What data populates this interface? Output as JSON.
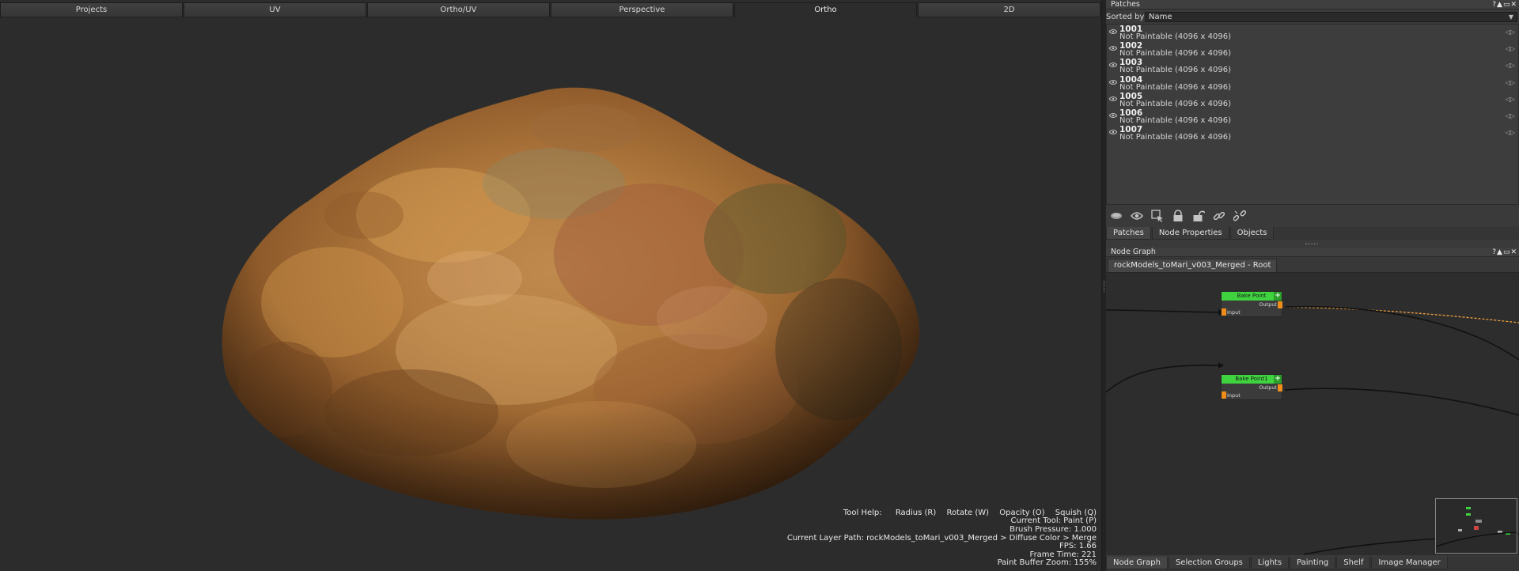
{
  "view_tabs": [
    {
      "label": "Projects",
      "active": false
    },
    {
      "label": "UV",
      "active": false
    },
    {
      "label": "Ortho/UV",
      "active": false
    },
    {
      "label": "Perspective",
      "active": false
    },
    {
      "label": "Ortho",
      "active": true
    },
    {
      "label": "2D",
      "active": false
    }
  ],
  "hud": {
    "help_label": "Tool Help:",
    "help_items": [
      "Radius (R)",
      "Rotate (W)",
      "Opacity (O)",
      "Squish (Q)"
    ],
    "lines": [
      "Current Tool: Paint (P)",
      "Brush Pressure: 1.000",
      "Current Layer Path: rockModels_toMari_v003_Merged > Diffuse Color > Merge",
      "FPS: 1.66",
      "Frame Time: 221",
      "Paint Buffer Zoom: 155%"
    ]
  },
  "patches_panel": {
    "title": "Patches",
    "window_buttons": "?▲▭✕",
    "sort_label": "Sorted by",
    "sort_value": "Name",
    "patches": [
      {
        "name": "1001",
        "state": "Not Paintable (4096 x 4096)"
      },
      {
        "name": "1002",
        "state": "Not Paintable (4096 x 4096)"
      },
      {
        "name": "1003",
        "state": "Not Paintable (4096 x 4096)"
      },
      {
        "name": "1004",
        "state": "Not Paintable (4096 x 4096)"
      },
      {
        "name": "1005",
        "state": "Not Paintable (4096 x 4096)"
      },
      {
        "name": "1006",
        "state": "Not Paintable (4096 x 4096)"
      },
      {
        "name": "1007",
        "state": "Not Paintable (4096 x 4096)"
      }
    ],
    "toolbar_icons": [
      "layers-icon",
      "eye-icon",
      "select-icon",
      "lock-icon",
      "unlock-icon",
      "link-icon",
      "unlink-icon"
    ],
    "tabs": [
      {
        "label": "Patches",
        "active": true
      },
      {
        "label": "Node Properties",
        "active": false
      },
      {
        "label": "Objects",
        "active": false
      }
    ]
  },
  "node_graph": {
    "title": "Node Graph",
    "window_buttons": "?▲▭✕",
    "breadcrumb_tab": "rockModels_toMari_v003_Merged - Root",
    "nodes": [
      {
        "title": "Bake Point",
        "output_label": "Output",
        "input_label": "Input"
      },
      {
        "title": "Bake Point1",
        "output_label": "Output",
        "input_label": "Input"
      }
    ],
    "node_color": "#3fd43f",
    "port_color": "#f08c1a"
  },
  "bottom_tabs": [
    {
      "label": "Node Graph",
      "active": true
    },
    {
      "label": "Selection Groups",
      "active": false
    },
    {
      "label": "Lights",
      "active": false
    },
    {
      "label": "Painting",
      "active": false
    },
    {
      "label": "Shelf",
      "active": false
    },
    {
      "label": "Image Manager",
      "active": false
    }
  ]
}
